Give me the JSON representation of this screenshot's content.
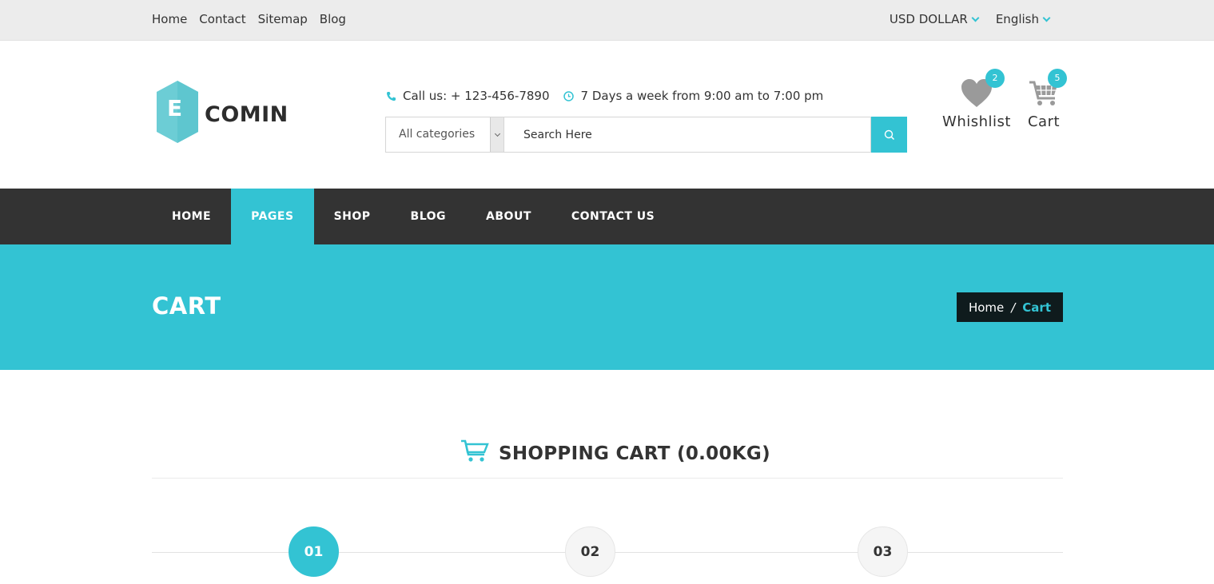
{
  "topbar": {
    "links": [
      "Home",
      "Contact",
      "Sitemap",
      "Blog"
    ],
    "currency": "USD DOLLAR",
    "language": "English"
  },
  "logo": {
    "letter": "E",
    "text": "COMIN"
  },
  "header": {
    "phone": "Call us: + 123-456-7890",
    "hours": "7 Days a week from 9:00 am to 7:00 pm",
    "category": "All categories",
    "search_placeholder": "Search Here",
    "wishlist": {
      "label": "Whishlist",
      "count": "2"
    },
    "cart": {
      "label": "Cart",
      "count": "5"
    }
  },
  "nav": {
    "items": [
      "HOME",
      "PAGES",
      "SHOP",
      "BLOG",
      "ABOUT",
      "CONTACT US"
    ],
    "active": "PAGES"
  },
  "banner": {
    "title": "CART",
    "breadcrumb": {
      "home": "Home",
      "separator": "/",
      "current": "Cart"
    }
  },
  "main": {
    "title": "SHOPPING CART (0.00KG)",
    "steps": [
      "01",
      "02",
      "03"
    ],
    "active_step": "01"
  },
  "colors": {
    "accent": "#33c3d3",
    "nav_bg": "#333333",
    "topbar_bg": "#ececec",
    "crumb_bg": "#0f1b1d"
  }
}
